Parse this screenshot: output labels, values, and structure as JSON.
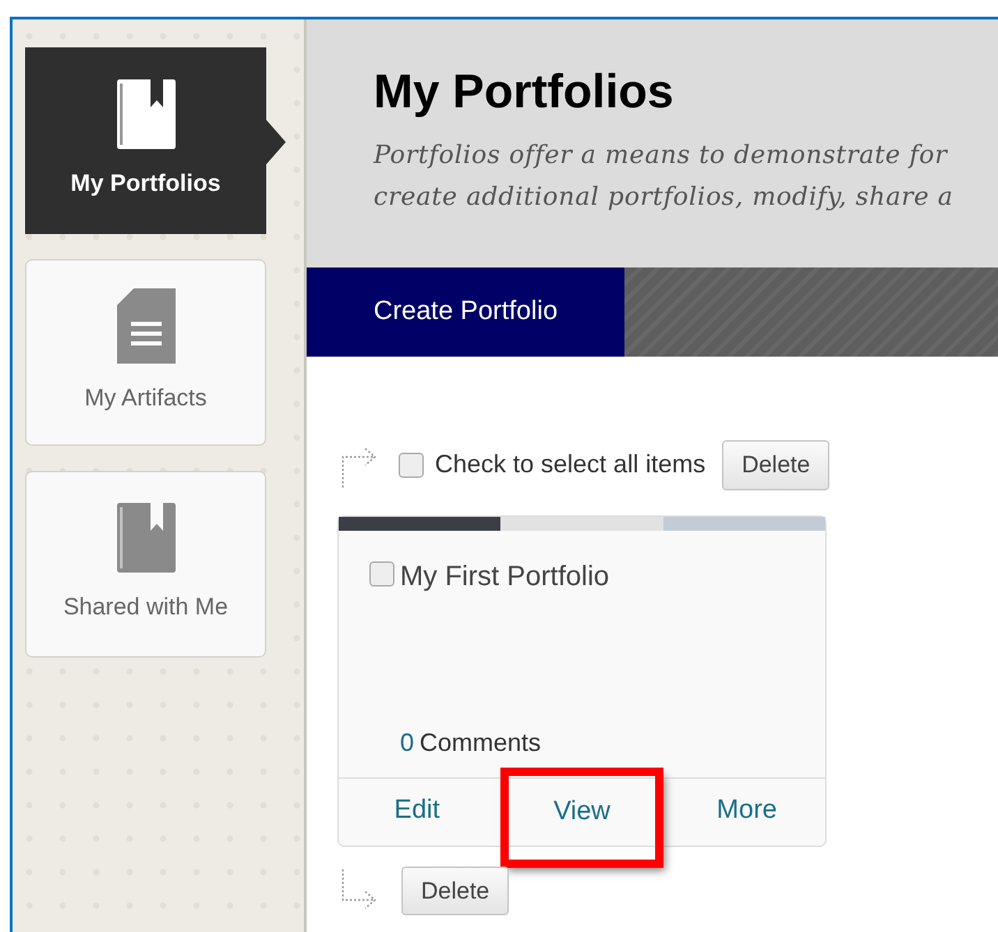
{
  "sidebar": {
    "items": [
      {
        "label": "My Portfolios",
        "kind": "book",
        "selected": true
      },
      {
        "label": "My Artifacts",
        "kind": "document",
        "selected": false
      },
      {
        "label": "Shared with Me",
        "kind": "book",
        "selected": false
      }
    ]
  },
  "header": {
    "title": "My Portfolios",
    "description_lines": [
      "Portfolios offer a means to demonstrate for",
      "create additional portfolios, modify, share a"
    ]
  },
  "action_bar": {
    "buttons": [
      {
        "label": "Create Portfolio"
      }
    ]
  },
  "select_all": {
    "label": "Check to select all items",
    "checked": false,
    "button": "Delete"
  },
  "portfolios": [
    {
      "title": "My First Portfolio",
      "checked": false,
      "comment_count": "0",
      "comment_label": "Comments",
      "actions": [
        {
          "label": "Edit",
          "highlighted": false
        },
        {
          "label": "View",
          "highlighted": true
        },
        {
          "label": "More",
          "highlighted": false
        }
      ]
    }
  ],
  "bottom_button": "Delete"
}
